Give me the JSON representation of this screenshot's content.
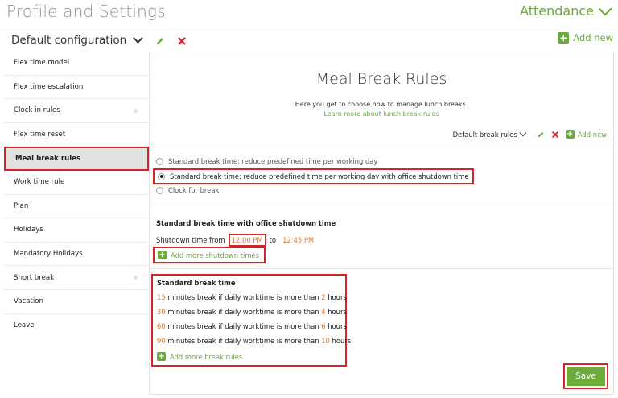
{
  "header": {
    "title": "Profile and Settings",
    "module": "Attendance",
    "configuration": "Default configuration",
    "add_new": "Add new"
  },
  "sidebar": {
    "items": [
      {
        "label": "Flex time model"
      },
      {
        "label": "Flex time escalation"
      },
      {
        "label": "Clock in rules"
      },
      {
        "label": "Flex time reset"
      },
      {
        "label": "Meal break rules"
      },
      {
        "label": "Work time rule"
      },
      {
        "label": "Plan"
      },
      {
        "label": "Holidays"
      },
      {
        "label": "Mandatory Holidays"
      },
      {
        "label": "Short break"
      },
      {
        "label": "Vacation"
      },
      {
        "label": "Leave"
      }
    ]
  },
  "main": {
    "title": "Meal Break Rules",
    "subtitle": "Here you get to choose how to manage lunch breaks.",
    "learn_more": "Learn more about lunch break rules",
    "rule_set": "Default break rules",
    "add_new": "Add new",
    "options": [
      {
        "label": "Standard break time: reduce predefined time per working day"
      },
      {
        "label": "Standard break time: reduce predefined time per working day with office shutdown time"
      },
      {
        "label": "Clock for break"
      }
    ],
    "shutdown": {
      "heading": "Standard break time with office shutdown time",
      "from_label": "Shutdown time from",
      "from_time": "12:00 PM",
      "to_label": "to",
      "to_time": "12:45 PM",
      "add_label": "Add more shutdown times"
    },
    "standard": {
      "heading": "Standard break time",
      "rules": [
        {
          "minutes": "15",
          "text": "minutes break if daily worktime is more than",
          "hours": "2",
          "unit": "hours"
        },
        {
          "minutes": "30",
          "text": "minutes break if daily worktime is more than",
          "hours": "4",
          "unit": "hours"
        },
        {
          "minutes": "60",
          "text": "minutes break if daily worktime is more than",
          "hours": "6",
          "unit": "hours"
        },
        {
          "minutes": "90",
          "text": "minutes break if daily worktime is more than",
          "hours": "10",
          "unit": "hours"
        }
      ],
      "add_label": "Add more break rules"
    },
    "save_label": "Save"
  },
  "colors": {
    "accent_green": "#6aab3a",
    "value_orange": "#e0782a",
    "highlight_red": "#d6242b"
  }
}
